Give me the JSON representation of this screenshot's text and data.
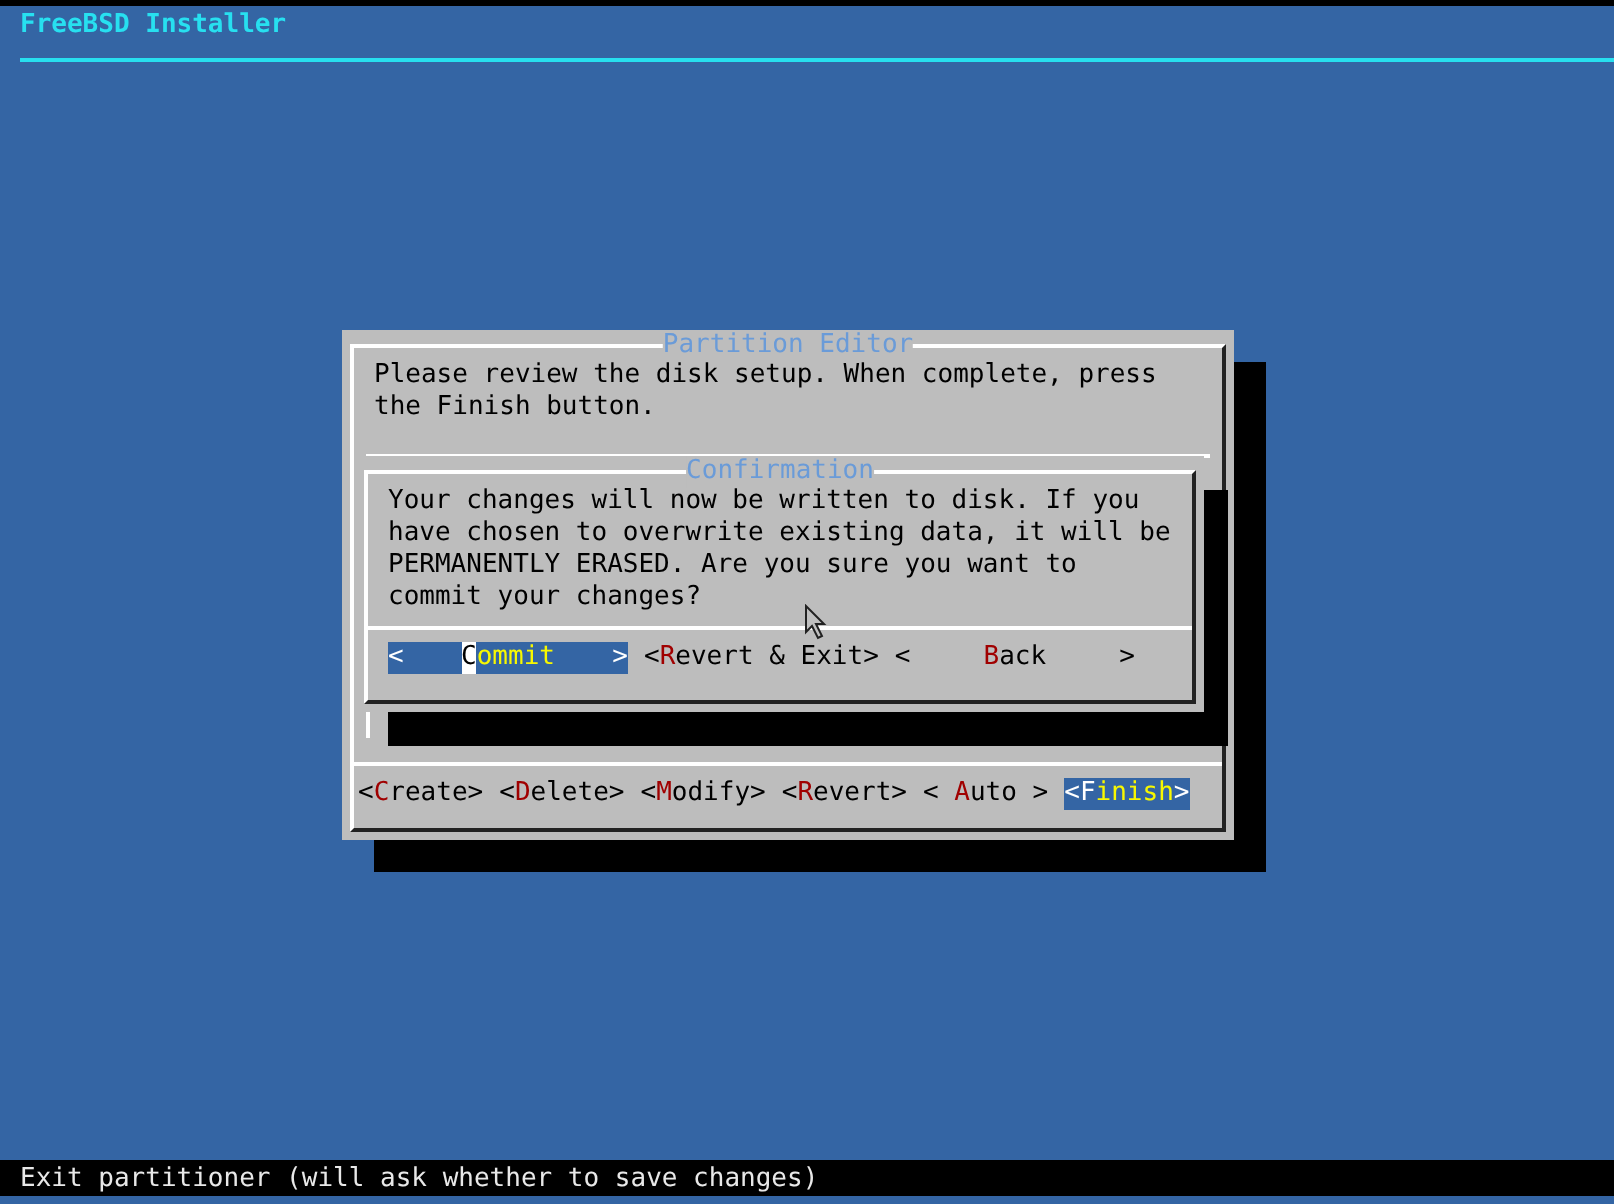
{
  "header": {
    "title": "FreeBSD Installer"
  },
  "partition_editor": {
    "title": "Partition Editor",
    "prompt": "Please review the disk setup. When complete, press the Finish button.",
    "buttons": [
      {
        "left": "<",
        "hotkey": "C",
        "rest": "reate",
        "right": ">",
        "selected": false,
        "cursor": false
      },
      {
        "left": "<",
        "hotkey": "D",
        "rest": "elete",
        "right": ">",
        "selected": false,
        "cursor": false
      },
      {
        "left": "<",
        "hotkey": "M",
        "rest": "odify",
        "right": ">",
        "selected": false,
        "cursor": false
      },
      {
        "left": "<",
        "hotkey": "R",
        "rest": "evert",
        "right": ">",
        "selected": false,
        "cursor": false
      },
      {
        "left": "< ",
        "hotkey": "A",
        "rest": "uto",
        "right": " >",
        "selected": false,
        "cursor": false
      },
      {
        "left": "<",
        "hotkey": "F",
        "rest": "inish",
        "right": ">",
        "selected": true,
        "cursor": false
      }
    ]
  },
  "confirmation": {
    "title": "Confirmation",
    "message": "Your changes will now be written to disk. If you have chosen to overwrite existing data, it will be PERMANENTLY ERASED. Are you sure you want to commit your changes?",
    "buttons": [
      {
        "left": "<",
        "hotkey": "C",
        "rest": "ommit",
        "right": ">",
        "selected": true,
        "cursor": true
      },
      {
        "left": "<",
        "hotkey": "R",
        "rest": "evert & Exit",
        "right": ">",
        "selected": false,
        "cursor": false
      },
      {
        "left": "<",
        "hotkey": "B",
        "rest": "ack",
        "right": ">",
        "selected": false,
        "cursor": false
      }
    ]
  },
  "status_bar": {
    "text": "Exit partitioner (will ask whether to save changes)"
  }
}
